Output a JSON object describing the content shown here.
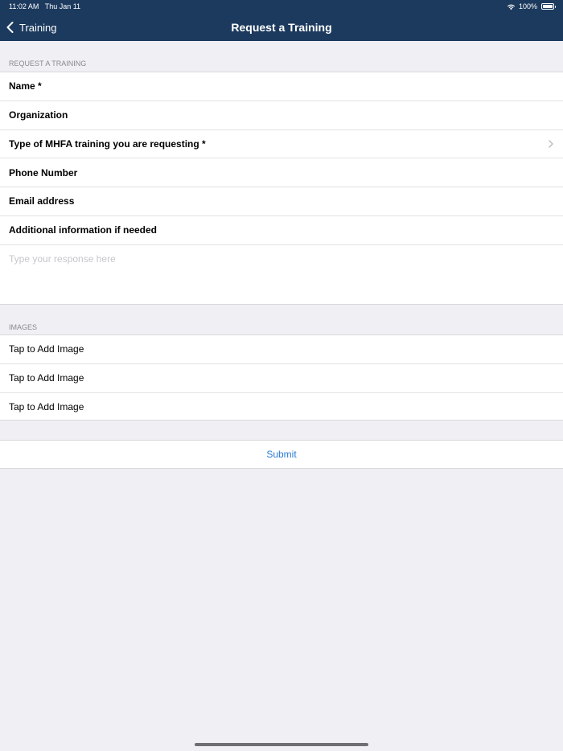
{
  "status_bar": {
    "time": "11:02 AM",
    "date": "Thu Jan 11",
    "battery": "100%",
    "wifi_icon": "wifi-icon",
    "battery_icon": "battery-icon"
  },
  "nav": {
    "back_label": "Training",
    "back_icon": "chevron-left-icon",
    "title": "Request a Training"
  },
  "form": {
    "section_header": "REQUEST A TRAINING",
    "fields": [
      {
        "label": "Name *"
      },
      {
        "label": "Organization"
      },
      {
        "label": "Type of MHFA training you are requesting *",
        "icon": "chevron-right-icon"
      },
      {
        "label": "Phone Number"
      },
      {
        "label": "Email address"
      },
      {
        "label": "Additional information if needed"
      }
    ],
    "response_placeholder": "Type your response here",
    "response_value": ""
  },
  "images": {
    "section_header": "IMAGES",
    "items": [
      {
        "label": "Tap to Add Image"
      },
      {
        "label": "Tap to Add Image"
      },
      {
        "label": "Tap to Add Image"
      }
    ]
  },
  "submit": {
    "label": "Submit"
  },
  "colors": {
    "nav_background": "#1c3a5e",
    "page_background": "#f0eff4",
    "accent": "#2a7bd4",
    "section_header_text": "#8a8a8e",
    "placeholder_text": "#c7c7cc"
  }
}
